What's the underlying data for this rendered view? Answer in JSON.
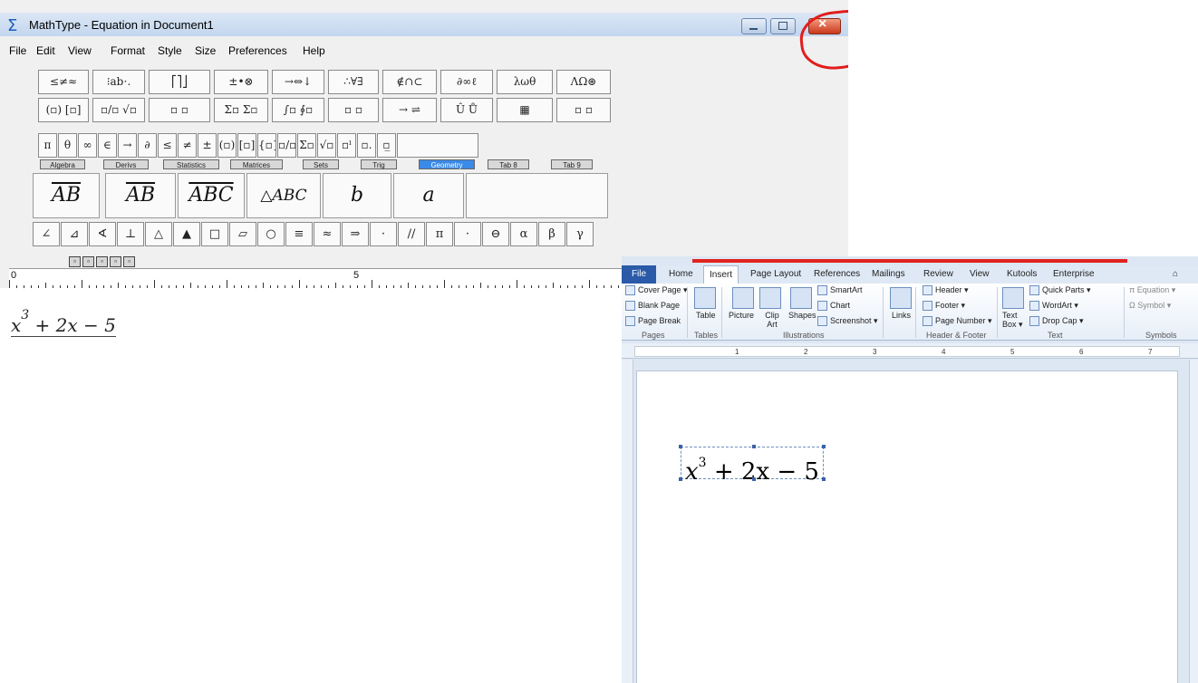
{
  "mathtype": {
    "title": "MathType - Equation in Document1",
    "menu": [
      "File",
      "Edit",
      "View",
      "Format",
      "Style",
      "Size",
      "Preferences",
      "Help"
    ],
    "palette_row1": [
      "≤≠≈",
      "⁝ab⋅.",
      "⎡⎤⎦",
      "±•⊗",
      "→⇔↓",
      "∴∀∃",
      "∉∩⊂",
      "∂∞ℓ",
      "λωθ",
      "ΛΩ⊛"
    ],
    "palette_row2": [
      "(▫) [▫]",
      "▫/▫ √▫",
      "▫ ▫",
      "Σ▫ Σ▫",
      "∫▫ ∮▫",
      "▫ ▫",
      "→ ⇌",
      "Û Ů",
      "▦",
      "▫ ▫"
    ],
    "symbols_row": [
      "π",
      "θ",
      "∞",
      "∈",
      "→",
      "∂",
      "≤",
      "≠",
      "±",
      "(▫)",
      "[▫]",
      "{▫}",
      "▫/▫",
      "Σ▫",
      "√▫",
      "▫ˡ",
      "▫.",
      "▫̲"
    ],
    "tabs": [
      "Algebra",
      "Derivs",
      "Statistics",
      "Matrices",
      "Sets",
      "Trig",
      "Geometry",
      "Tab 8",
      "Tab 9"
    ],
    "active_tab": "Geometry",
    "templates": [
      "AB",
      "AB",
      "ABC",
      "△ABC",
      "b",
      "a"
    ],
    "geometry_row": [
      "∠",
      "⊿",
      "∢",
      "⊥",
      "△",
      "▲",
      "□",
      "▱",
      "○",
      "≡",
      "≈",
      "⇒",
      "·",
      "//",
      "π",
      "·",
      "⊖",
      "α",
      "β",
      "γ"
    ],
    "ruler_labels": [
      "0",
      "5"
    ],
    "equation": "x³ + 2x − 5",
    "equation_base": "x",
    "equation_sup": "3",
    "equation_rest": " + 2x − 5"
  },
  "word": {
    "tabs": [
      "File",
      "Home",
      "Insert",
      "Page Layout",
      "References",
      "Mailings",
      "Review",
      "View",
      "Kutools",
      "Enterprise"
    ],
    "active_tab": "Insert",
    "ribbon": {
      "pages": [
        "Cover Page ▾",
        "Blank Page",
        "Page Break"
      ],
      "pages_group": "Pages",
      "table": "Table",
      "tables_group": "Tables",
      "picture": "Picture",
      "clip_art": "Clip Art",
      "shapes": "Shapes",
      "smartart": "SmartArt",
      "chart": "Chart",
      "screenshot": "Screenshot ▾",
      "illustrations_group": "Illustrations",
      "links": "Links",
      "header": "Header ▾",
      "footer": "Footer ▾",
      "page_number": "Page Number ▾",
      "header_footer_group": "Header & Footer",
      "text_box": "Text Box ▾",
      "quick_parts": "Quick Parts ▾",
      "wordart": "WordArt ▾",
      "drop_cap": "Drop Cap ▾",
      "text_group": "Text",
      "equation": "Equation ▾",
      "symbol": "Symbol ▾",
      "symbols_group": "Symbols"
    },
    "ruler_labels": [
      "1",
      "2",
      "3",
      "4",
      "5",
      "6",
      "7"
    ],
    "equation_base": "x",
    "equation_sup": "3",
    "equation_rest": " + 2x − 5"
  },
  "colors": {
    "annotation_red": "#e21d1d",
    "word_file_tab": "#2a5aa8",
    "geometry_tab": "#3a8ae8"
  }
}
